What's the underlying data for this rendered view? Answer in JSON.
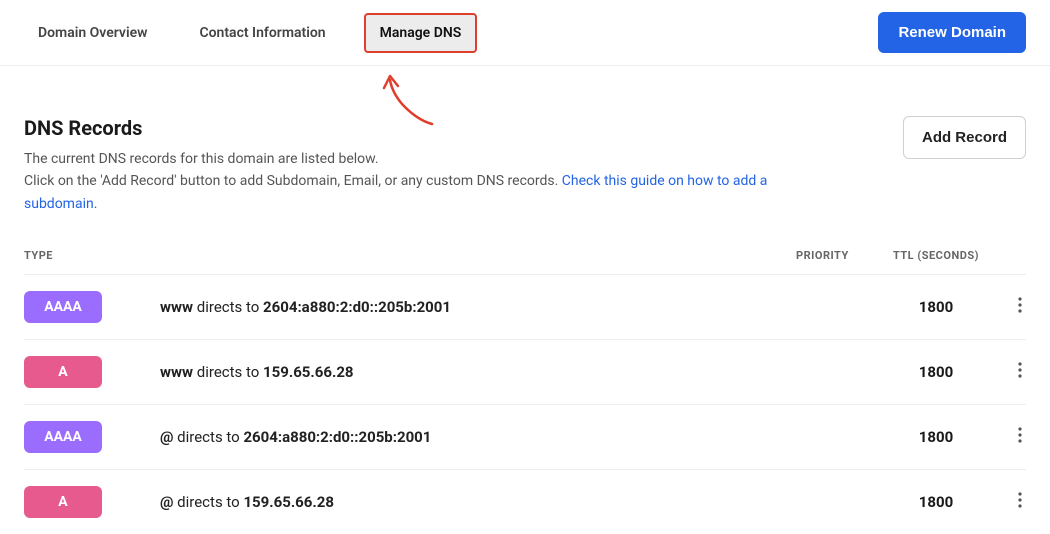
{
  "tabs": [
    {
      "label": "Domain Overview",
      "active": false
    },
    {
      "label": "Contact Information",
      "active": false
    },
    {
      "label": "Manage DNS",
      "active": true
    }
  ],
  "renew_label": "Renew Domain",
  "section_title": "DNS Records",
  "desc_line1": "The current DNS records for this domain are listed below.",
  "desc_line2_prefix": "Click on the 'Add Record' button to add Subdomain, Email, or any custom DNS records. ",
  "desc_link": "Check this guide on how to add a subdomain",
  "desc_suffix": ".",
  "add_record_label": "Add Record",
  "columns": {
    "type": "TYPE",
    "priority": "PRIORITY",
    "ttl": "TTL (SECONDS)"
  },
  "directs_to_text": "directs to",
  "records": [
    {
      "type": "AAAA",
      "type_class": "type-aaaa",
      "name": "www",
      "value": "2604:a880:2:d0::205b:2001",
      "ttl": "1800"
    },
    {
      "type": "A",
      "type_class": "type-a",
      "name": "www",
      "value": "159.65.66.28",
      "ttl": "1800"
    },
    {
      "type": "AAAA",
      "type_class": "type-aaaa",
      "name": "@",
      "value": "2604:a880:2:d0::205b:2001",
      "ttl": "1800"
    },
    {
      "type": "A",
      "type_class": "type-a",
      "name": "@",
      "value": "159.65.66.28",
      "ttl": "1800"
    }
  ],
  "colors": {
    "accent": "#2264e5",
    "highlight_border": "#e03e2d"
  }
}
